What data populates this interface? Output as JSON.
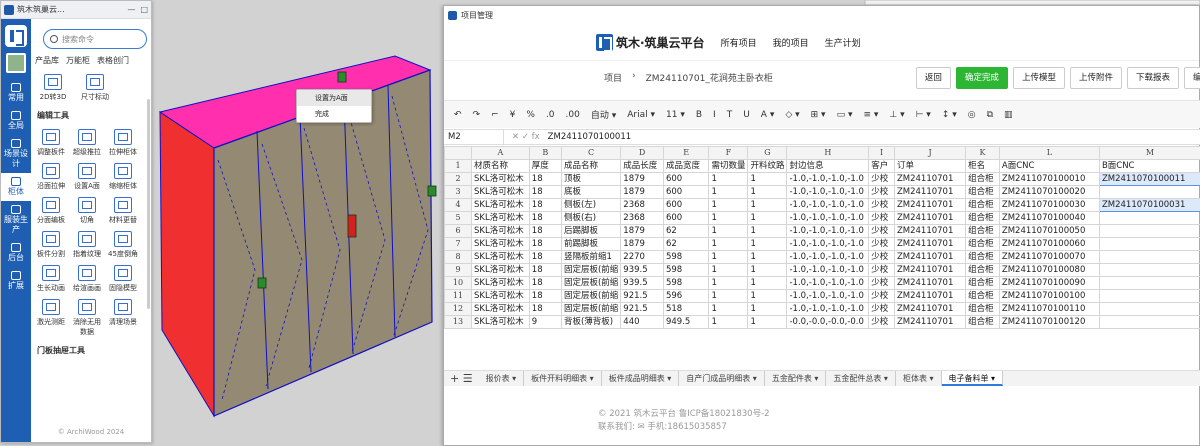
{
  "left_panel": {
    "title": "筑木筑巢云...",
    "search_placeholder": "搜索命令",
    "tabs": [
      "产品库",
      "万能柜",
      "表格创门"
    ],
    "top_tools": [
      "2D转3D",
      "尺寸标动"
    ],
    "section_edit": "编辑工具",
    "tools": [
      "调整板件",
      "超级推拉",
      "拉伸柜体",
      "沿面拉伸",
      "设置A面",
      "缩缩柜体",
      "分面编板",
      "切角",
      "材料更替",
      "板件分割",
      "指着纹理",
      "45度倒角",
      "生长动画",
      "给渲画画",
      "固隐模型",
      "激光测距",
      "消除无用数据",
      "清理场景"
    ],
    "section_door": "门板抽屉工具",
    "footer": "© ArchiWood 2024",
    "rail": [
      "常用",
      "全局",
      "场景设计",
      "柜体",
      "服装生产",
      "后台",
      "扩展"
    ]
  },
  "context_menu": [
    "设置为A面",
    "完成"
  ],
  "window": {
    "title": "项目管理",
    "brand": "筑木·筑巢云平台",
    "nav": [
      "所有项目",
      "我的项目",
      "生产计划"
    ],
    "crumb_home": "项目",
    "crumb_sep": "›",
    "crumb_current": "ZM24110701_花涧苑主卧衣柜",
    "buttons": [
      "返回",
      "确定完成",
      "上传模型",
      "上传附件",
      "下载报表",
      "编辑"
    ],
    "toolbar": [
      "↶",
      "↷",
      "⌐",
      "¥",
      "%",
      ".0",
      ".00",
      "自动 ▾",
      "Arial ▾",
      "11 ▾",
      "B",
      "I",
      "T",
      "U",
      "A ▾",
      "◇ ▾",
      "⊞ ▾",
      "▭ ▾",
      "≡ ▾",
      "⊥ ▾",
      "⊢ ▾",
      "↕ ▾",
      "◎",
      "⧉",
      "▥"
    ],
    "cell_ref": "M2",
    "formula": "ZM2411070100011",
    "columns": [
      "",
      "A",
      "B",
      "C",
      "D",
      "E",
      "F",
      "G",
      "H",
      "I",
      "J",
      "K",
      "L",
      "M"
    ],
    "header_row": [
      "材质名称",
      "厚度",
      "成品名称",
      "成品长度",
      "成品宽度",
      "需切数量",
      "开料纹路",
      "封边信息",
      "客户",
      "订单",
      "柜名",
      "A面CNC",
      "B面CNC"
    ],
    "rows": [
      [
        "SKL洛可松木",
        "18",
        "顶板",
        "1879",
        "600",
        "1",
        "1",
        "-1.0,-1.0,-1.0,-1.0",
        "少校",
        "ZM24110701",
        "组合柜",
        "ZM2411070100010",
        "ZM2411070100011"
      ],
      [
        "SKL洛可松木",
        "18",
        "底板",
        "1879",
        "600",
        "1",
        "1",
        "-1.0,-1.0,-1.0,-1.0",
        "少校",
        "ZM24110701",
        "组合柜",
        "ZM2411070100020",
        ""
      ],
      [
        "SKL洛可松木",
        "18",
        "侧板(左)",
        "2368",
        "600",
        "1",
        "1",
        "-1.0,-1.0,-1.0,-1.0",
        "少校",
        "ZM24110701",
        "组合柜",
        "ZM2411070100030",
        "ZM2411070100031"
      ],
      [
        "SKL洛可松木",
        "18",
        "侧板(右)",
        "2368",
        "600",
        "1",
        "1",
        "-1.0,-1.0,-1.0,-1.0",
        "少校",
        "ZM24110701",
        "组合柜",
        "ZM2411070100040",
        ""
      ],
      [
        "SKL洛可松木",
        "18",
        "后踢脚板",
        "1879",
        "62",
        "1",
        "1",
        "-1.0,-1.0,-1.0,-1.0",
        "少校",
        "ZM24110701",
        "组合柜",
        "ZM2411070100050",
        ""
      ],
      [
        "SKL洛可松木",
        "18",
        "前踢脚板",
        "1879",
        "62",
        "1",
        "1",
        "-1.0,-1.0,-1.0,-1.0",
        "少校",
        "ZM24110701",
        "组合柜",
        "ZM2411070100060",
        ""
      ],
      [
        "SKL洛可松木",
        "18",
        "竖隔板前缩1",
        "2270",
        "598",
        "1",
        "1",
        "-1.0,-1.0,-1.0,-1.0",
        "少校",
        "ZM24110701",
        "组合柜",
        "ZM2411070100070",
        ""
      ],
      [
        "SKL洛可松木",
        "18",
        "固定层板(前缩",
        "939.5",
        "598",
        "1",
        "1",
        "-1.0,-1.0,-1.0,-1.0",
        "少校",
        "ZM24110701",
        "组合柜",
        "ZM2411070100080",
        ""
      ],
      [
        "SKL洛可松木",
        "18",
        "固定层板(前缩",
        "939.5",
        "598",
        "1",
        "1",
        "-1.0,-1.0,-1.0,-1.0",
        "少校",
        "ZM24110701",
        "组合柜",
        "ZM2411070100090",
        ""
      ],
      [
        "SKL洛可松木",
        "18",
        "固定层板(前缩",
        "921.5",
        "596",
        "1",
        "1",
        "-1.0,-1.0,-1.0,-1.0",
        "少校",
        "ZM24110701",
        "组合柜",
        "ZM2411070100100",
        ""
      ],
      [
        "SKL洛可松木",
        "18",
        "固定层板(前缩",
        "921.5",
        "518",
        "1",
        "1",
        "-1.0,-1.0,-1.0,-1.0",
        "少校",
        "ZM24110701",
        "组合柜",
        "ZM2411070100110",
        ""
      ],
      [
        "SKL洛可松木",
        "9",
        "背板(薄背板)",
        "440",
        "949.5",
        "1",
        "1",
        "-0.0,-0.0,-0.0,-0.0",
        "少校",
        "ZM24110701",
        "组合柜",
        "ZM2411070100120",
        ""
      ]
    ],
    "sheet_tabs": [
      "报价表",
      "板件开料明细表",
      "板件成品明细表",
      "自产门成品明细表",
      "五金配件表",
      "五金配件总表",
      "柜体表",
      "电子备料单"
    ],
    "active_sheet_tab": 7,
    "footer_line1": "© 2021 筑木云平台 鲁ICP备18021830号-2",
    "footer_line2": "联系我们: ✉ 手机:18615035857"
  }
}
